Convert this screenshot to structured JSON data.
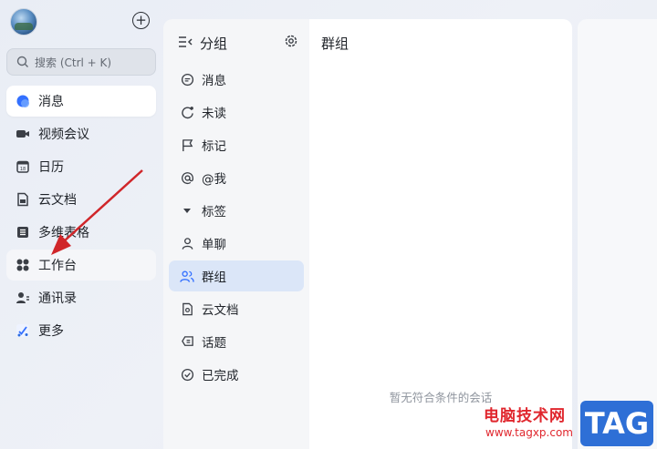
{
  "sidebar": {
    "search_placeholder": "搜索 (Ctrl + K)",
    "items": [
      {
        "label": "消息",
        "icon": "message-icon"
      },
      {
        "label": "视频会议",
        "icon": "video-icon"
      },
      {
        "label": "日历",
        "icon": "calendar-icon"
      },
      {
        "label": "云文档",
        "icon": "doc-icon"
      },
      {
        "label": "多维表格",
        "icon": "table-icon"
      },
      {
        "label": "工作台",
        "icon": "apps-icon"
      },
      {
        "label": "通讯录",
        "icon": "contacts-icon"
      },
      {
        "label": "更多",
        "icon": "more-icon"
      }
    ]
  },
  "panel": {
    "title": "分组",
    "items": [
      {
        "label": "消息"
      },
      {
        "label": "未读"
      },
      {
        "label": "标记"
      },
      {
        "label": "@我"
      },
      {
        "label": "标签"
      },
      {
        "label": "单聊"
      },
      {
        "label": "群组"
      },
      {
        "label": "云文档"
      },
      {
        "label": "话题"
      },
      {
        "label": "已完成"
      }
    ]
  },
  "main": {
    "title": "群组",
    "empty_text": "暂无符合条件的会话"
  },
  "watermark": {
    "text": "电脑技术网",
    "url": "www.tagxp.com",
    "tag": "TAG"
  },
  "colors": {
    "accent": "#3370ff",
    "selected_bg": "#dbe6f8",
    "arrow": "#d0262a"
  }
}
